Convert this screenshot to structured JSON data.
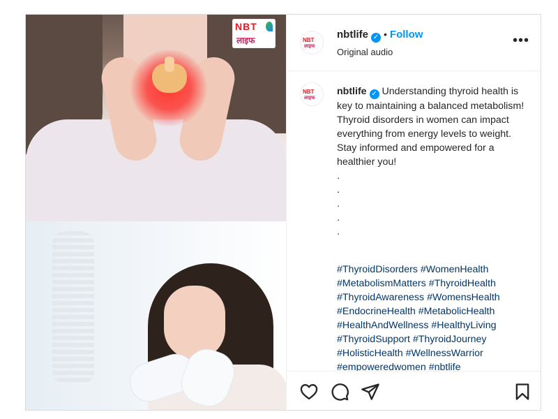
{
  "post": {
    "username": "nbtlife",
    "follow_label": "Follow",
    "audio_label": "Original audio",
    "more_label": "•••",
    "logo": {
      "latin": "NBT",
      "hindi": "लाइफ"
    },
    "caption": "Understanding thyroid health is key to maintaining a balanced metabolism! Thyroid disorders in women can impact everything from energy levels to weight. Stay informed and empowered for a healthier you!",
    "dots": [
      ".",
      ".",
      ".",
      ".",
      "."
    ],
    "hashtags": [
      "#ThyroidDisorders",
      "#WomenHealth",
      "#MetabolismMatters",
      "#ThyroidHealth",
      "#ThyroidAwareness",
      "#WomensHealth",
      "#EndocrineHealth",
      "#MetabolicHealth",
      "#HealthAndWellness",
      "#HealthyLiving",
      "#ThyroidSupport",
      "#ThyroidJourney",
      "#HolisticHealth",
      "#WellnessWarrior",
      "#empoweredwomen",
      "#nbtlife"
    ]
  },
  "icons": {
    "like": "heart-icon",
    "comment": "comment-icon",
    "share": "send-icon",
    "save": "bookmark-icon",
    "verified": "verified-badge-icon"
  },
  "colors": {
    "accent": "#0095f6",
    "hashtag": "#00376b",
    "brand_red": "#e01b24"
  }
}
